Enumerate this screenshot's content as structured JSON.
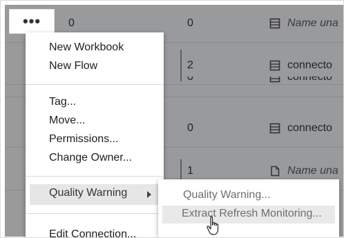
{
  "more_button": {
    "label": "•••"
  },
  "rows": [
    {
      "count": "0",
      "count2": "0",
      "icon": "data-source-icon",
      "name": "Name una",
      "italic": true
    },
    {
      "count": "",
      "count2": "2",
      "icon": "data-source-icon",
      "name": "connecto",
      "italic": false
    },
    {
      "count": "",
      "count2": "0",
      "icon": "data-source-icon",
      "name": "connecto",
      "italic": false
    },
    {
      "count": "",
      "count2": "0",
      "icon": "data-source-icon",
      "name": "connecto",
      "italic": false
    },
    {
      "count": "",
      "count2": "1",
      "icon": "document-icon",
      "name": "Name una",
      "italic": true
    },
    {
      "count": "",
      "count2": "",
      "icon": "",
      "name": "",
      "italic": false
    }
  ],
  "menu": {
    "new_workbook": "New Workbook",
    "new_flow": "New Flow",
    "tag": "Tag...",
    "move": "Move...",
    "permissions": "Permissions...",
    "change_owner": "Change Owner...",
    "quality_warning": "Quality Warning",
    "edit_connection": "Edit Connection..."
  },
  "submenu": {
    "quality_warning": "Quality Warning...",
    "extract_refresh_monitoring": "Extract Refresh Monitoring..."
  },
  "colors": {
    "overlay": "#999a9c",
    "menu_bg": "#ffffff",
    "highlight": "#e6e6e6"
  }
}
